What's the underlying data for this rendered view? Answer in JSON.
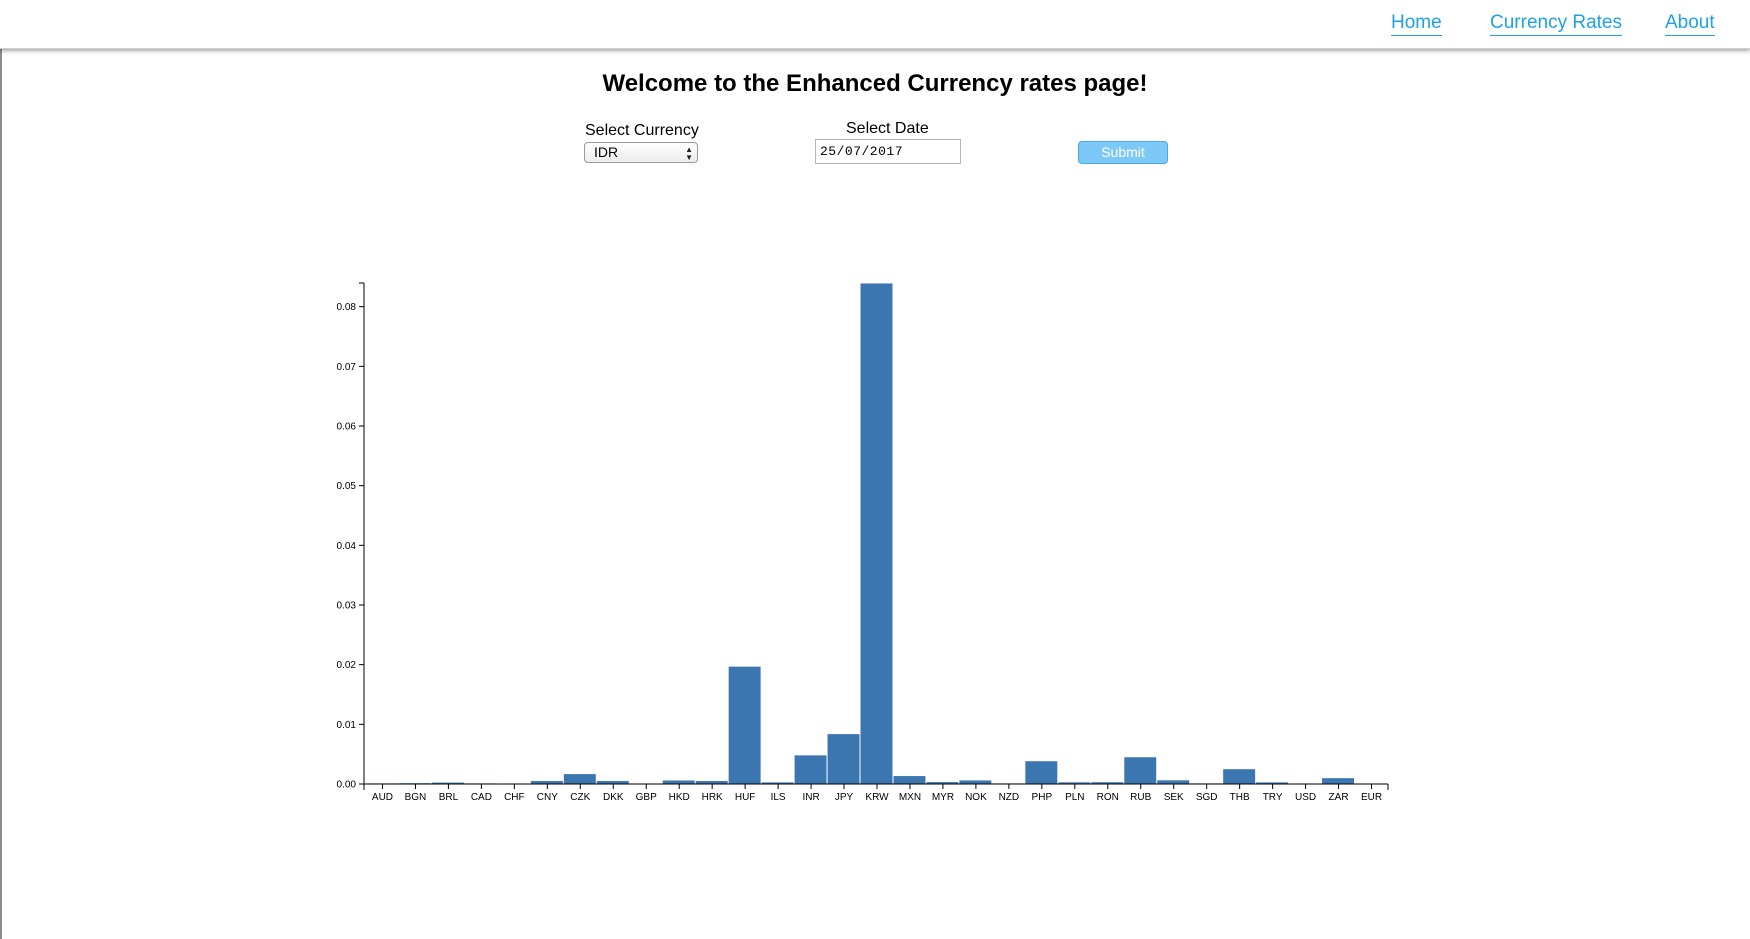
{
  "nav": {
    "home": "Home",
    "currency_rates": "Currency Rates",
    "about": "About"
  },
  "page": {
    "title": "Welcome to the Enhanced Currency rates page!"
  },
  "form": {
    "currency_label": "Select Currency",
    "currency_value": "IDR",
    "date_label": "Select Date",
    "date_value": "25/07/2017",
    "submit_label": "Submit"
  },
  "colors": {
    "bar": "#3b76b0",
    "link": "#1ea1e6",
    "submit_bg": "#7cc8f7"
  },
  "chart_data": {
    "type": "bar",
    "categories": [
      "AUD",
      "BGN",
      "BRL",
      "CAD",
      "CHF",
      "CNY",
      "CZK",
      "DKK",
      "GBP",
      "HKD",
      "HRK",
      "HUF",
      "ILS",
      "INR",
      "JPY",
      "KRW",
      "MXN",
      "MYR",
      "NOK",
      "NZD",
      "PHP",
      "PLN",
      "RON",
      "RUB",
      "SEK",
      "SGD",
      "THB",
      "TRY",
      "USD",
      "ZAR",
      "EUR"
    ],
    "values": [
      0.0001,
      0.00013,
      0.00024,
      0.0001,
      7e-05,
      0.0005,
      0.00166,
      0.0005,
      6e-05,
      0.00059,
      0.0005,
      0.01967,
      0.00027,
      0.0048,
      0.00836,
      0.08389,
      0.00133,
      0.00032,
      0.0006,
      0.0001,
      0.00382,
      0.00028,
      0.0003,
      0.00448,
      0.00062,
      0.0001,
      0.00248,
      0.00027,
      8e-05,
      0.00098,
      6e-05
    ],
    "yticks": [
      "0.00",
      "0.01",
      "0.02",
      "0.03",
      "0.04",
      "0.05",
      "0.06",
      "0.07",
      "0.08"
    ],
    "ylim": [
      0,
      0.0838
    ],
    "xlabel": "",
    "ylabel": "",
    "title": "",
    "grid": false,
    "legend": "none"
  }
}
